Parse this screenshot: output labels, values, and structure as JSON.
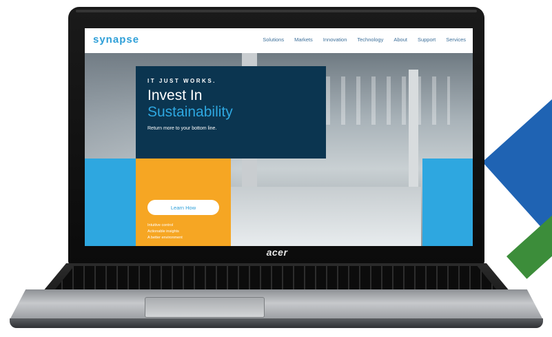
{
  "laptop": {
    "brand": "acer"
  },
  "website": {
    "logo": "synapse",
    "nav": [
      "Solutions",
      "Markets",
      "Innovation",
      "Technology",
      "About",
      "Support",
      "Services"
    ],
    "hero": {
      "tagline": "IT JUST WORKS.",
      "headline_line1": "Invest In",
      "headline_line2": "Sustainability",
      "subtitle": "Return more to your bottom line.",
      "cta_label": "Learn How",
      "features": [
        "Intuitive control",
        "Actionable insights",
        "A better environment"
      ]
    }
  },
  "colors": {
    "brand_blue": "#2ea7e0",
    "navy": "#0b3550",
    "orange": "#f6a623",
    "background_stripe_blue": "#1f63b3",
    "background_stripe_green": "#3c8d3a"
  }
}
